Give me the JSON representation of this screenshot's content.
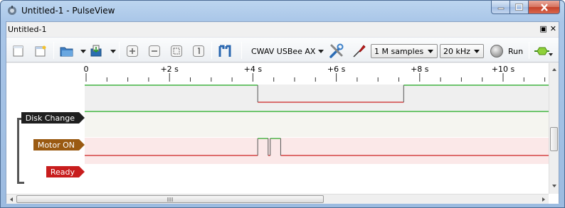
{
  "window": {
    "title": "Untitled-1 - PulseView"
  },
  "dock": {
    "title": "Untitled-1",
    "float_glyph": "▣",
    "close_glyph": "✕"
  },
  "toolbar": {
    "device": "CWAV USBee AX",
    "samples": "1 M samples",
    "samplerate": "20 kHz",
    "run_label": "Run",
    "icons": [
      "new-session-icon",
      "new-view-icon",
      "open-icon",
      "save-icon",
      "zoom-in-icon",
      "zoom-out-icon",
      "zoom-fit-icon",
      "zoom-one-to-one-icon",
      "cursor-icon",
      "device-config-icon",
      "probe-config-icon",
      "run-icon",
      "decoder-icon"
    ]
  },
  "ruler": {
    "ticks": [
      {
        "label": "0",
        "seconds": 0
      },
      {
        "label": "+2 s",
        "seconds": 2
      },
      {
        "label": "+4 s",
        "seconds": 4
      },
      {
        "label": "+6 s",
        "seconds": 6
      },
      {
        "label": "+8 s",
        "seconds": 8
      },
      {
        "label": "+10 s",
        "seconds": 10
      }
    ]
  },
  "signals": [
    {
      "name": "Disk Change",
      "color": "#1f1f1f",
      "transitions": [
        [
          0,
          1
        ],
        [
          4.15,
          0
        ],
        [
          7.65,
          1
        ]
      ]
    },
    {
      "name": "Motor ON",
      "color": "#9a5a12",
      "transitions": [
        [
          0,
          1
        ]
      ]
    },
    {
      "name": "Ready",
      "color": "#c81d1d",
      "transitions": [
        [
          0,
          0
        ],
        [
          4.15,
          1
        ],
        [
          4.4,
          0
        ],
        [
          4.45,
          1
        ],
        [
          4.7,
          0
        ]
      ]
    }
  ],
  "colors": {
    "high": "#22aa22",
    "low": "#cc2222",
    "row_alt": "#f5f5f0",
    "ready_bg": "#fbe8e8"
  }
}
